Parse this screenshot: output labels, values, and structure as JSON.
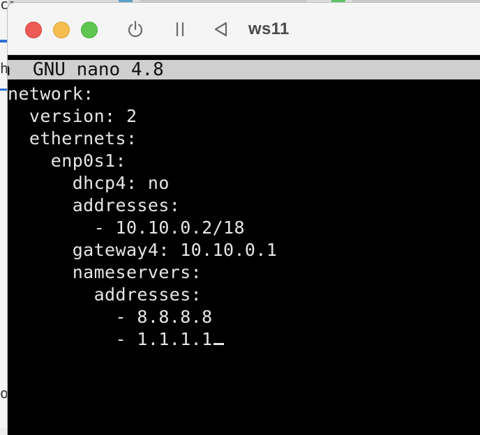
{
  "window": {
    "title": "ws11",
    "icons": [
      "power-icon",
      "pause-icon",
      "back-triangle-icon"
    ]
  },
  "background_fragments": {
    "top_left": "ci",
    "left_mid": "h",
    "left_bottom": "or"
  },
  "nano": {
    "header": "GNU nano 4.8"
  },
  "editor_lines": [
    "network:",
    "  version: 2",
    "  ethernets:",
    "    enp0s1:",
    "      dhcp4: no",
    "      addresses:",
    "        - 10.10.0.2/18",
    "      gateway4: 10.10.0.1",
    "      nameservers:",
    "        addresses:",
    "          - 8.8.8.8",
    "          - 1.1.1.1"
  ],
  "colors": {
    "terminal_bg": "#000000",
    "terminal_fg": "#e6e6e6",
    "nano_header_bg": "#cfcfcf",
    "close": "#ee5b56",
    "minimize": "#f5be4f",
    "zoom": "#5ec650"
  }
}
